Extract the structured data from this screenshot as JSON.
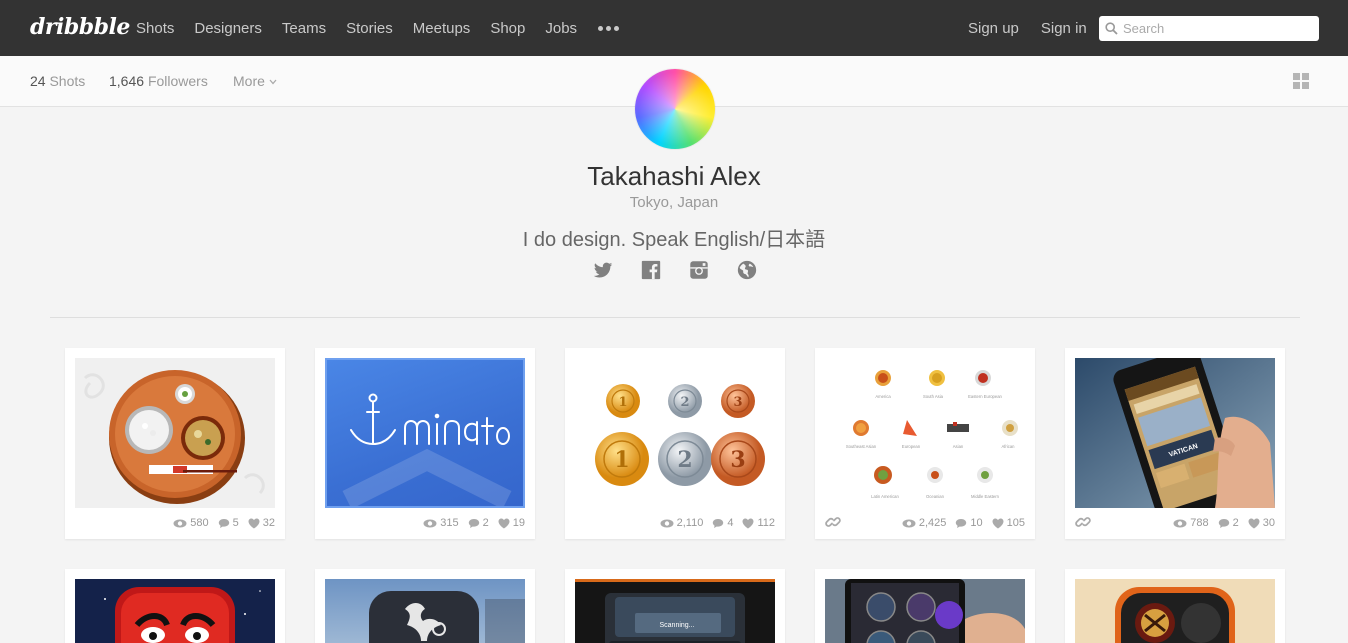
{
  "nav": {
    "logo": "dribbble",
    "links": [
      "Shots",
      "Designers",
      "Teams",
      "Stories",
      "Meetups",
      "Shop",
      "Jobs"
    ],
    "more_icon": "more-dots-icon",
    "signup": "Sign up",
    "signin": "Sign in",
    "search_placeholder": "Search"
  },
  "subnav": {
    "shots_count": "24",
    "shots_label": "Shots",
    "followers_count": "1,646",
    "followers_label": "Followers",
    "more": "More",
    "view_icon": "grid-view-icon"
  },
  "profile": {
    "name": "Takahashi Alex",
    "location": "Tokyo, Japan",
    "bio": "I do design. Speak English/日本語",
    "socials": [
      "twitter-icon",
      "facebook-icon",
      "instagram-icon",
      "globe-icon"
    ]
  },
  "shots": [
    {
      "views": "580",
      "comments": "5",
      "likes": "32",
      "has_link": false
    },
    {
      "views": "315",
      "comments": "2",
      "likes": "19",
      "has_link": false,
      "title": "minato"
    },
    {
      "views": "2,110",
      "comments": "4",
      "likes": "112",
      "has_link": false
    },
    {
      "views": "2,425",
      "comments": "10",
      "likes": "105",
      "has_link": true,
      "food_labels": [
        "America",
        "South Asia",
        "Eastern European",
        "Southeast Asian",
        "European",
        "Asian",
        "African",
        "Latin American",
        "Oceanian",
        "Middle Eastern"
      ]
    },
    {
      "views": "788",
      "comments": "2",
      "likes": "30",
      "has_link": true,
      "screen_text": "VATICAN"
    }
  ],
  "row2_shot_text": "Scanning...",
  "colors": {
    "nav_bg": "#333333",
    "page_bg": "#f4f4f4",
    "minato_blue": "#3e77db"
  }
}
